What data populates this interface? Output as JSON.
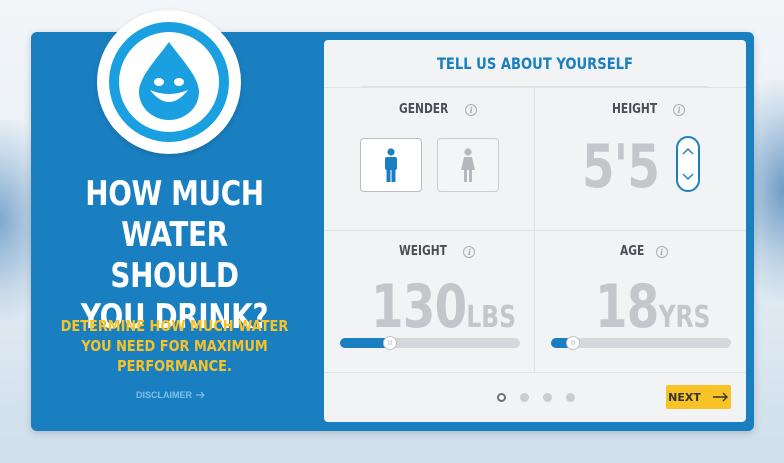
{
  "hero": {
    "headline_lines": [
      "HOW MUCH",
      "WATER SHOULD",
      "YOU DRINK?"
    ],
    "subhead_lines": [
      "DETERMINE HOW MUCH WATER",
      "YOU NEED FOR MAXIMUM",
      "PERFORMANCE."
    ],
    "disclaimer": "DISCLAIMER",
    "logo_icon": "water-drop-smile-icon"
  },
  "form": {
    "title": "TELL US ABOUT YOURSELF",
    "gender": {
      "label": "GENDER",
      "options": [
        "male",
        "female"
      ],
      "selected": "male"
    },
    "height": {
      "label": "HEIGHT",
      "value": "5'5"
    },
    "weight": {
      "label": "WEIGHT",
      "value": "130",
      "unit": "LBS",
      "slider_fraction": 0.28
    },
    "age": {
      "label": "AGE",
      "value": "18",
      "unit": "YRS",
      "slider_fraction": 0.12
    },
    "info_icon": "i",
    "pagination": {
      "pages": 4,
      "current": 1
    },
    "next_label": "NEXT"
  },
  "colors": {
    "brand_blue": "#1a7fc1",
    "accent_yellow": "#f7c327",
    "value_gray": "#c3c7cb"
  }
}
